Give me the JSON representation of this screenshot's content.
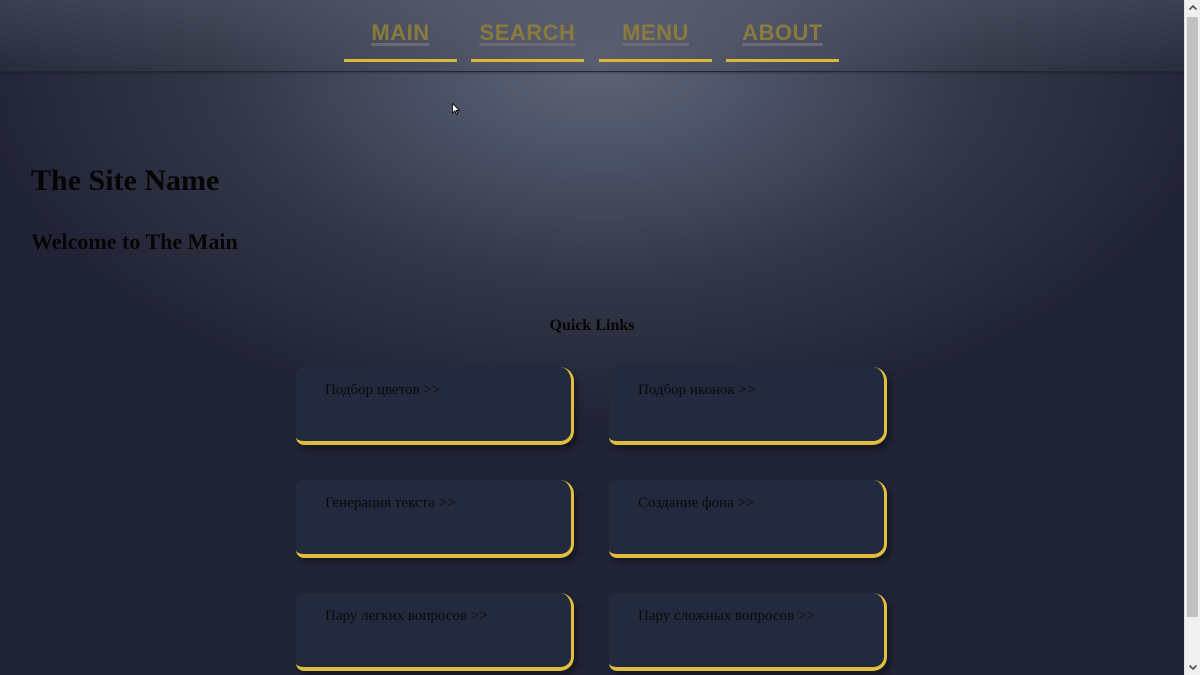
{
  "nav": {
    "items": [
      {
        "label": "MAIN"
      },
      {
        "label": "SEARCH"
      },
      {
        "label": "MENU"
      },
      {
        "label": "ABOUT"
      }
    ]
  },
  "header": {
    "site_name": "The Site Name",
    "welcome": "Welcome to The Main"
  },
  "quick_links": {
    "title": "Quick Links",
    "items": [
      {
        "label": "Подбор цветов >>"
      },
      {
        "label": "Подбор иконок >>"
      },
      {
        "label": "Генерация текста >>"
      },
      {
        "label": "Создание фона >>"
      },
      {
        "label": "Пару легких вопросов >>"
      },
      {
        "label": "Пару сложных вопросов >>"
      }
    ]
  },
  "colors": {
    "accent": "#e0bf3e",
    "nav_text": "#8a7a3c",
    "card_bg": "#242a3e",
    "page_bg": "#212436"
  },
  "icons": {
    "cursor": "mouse-pointer-icon",
    "scroll_up": "chevron-up-icon",
    "scroll_down": "chevron-down-icon"
  }
}
